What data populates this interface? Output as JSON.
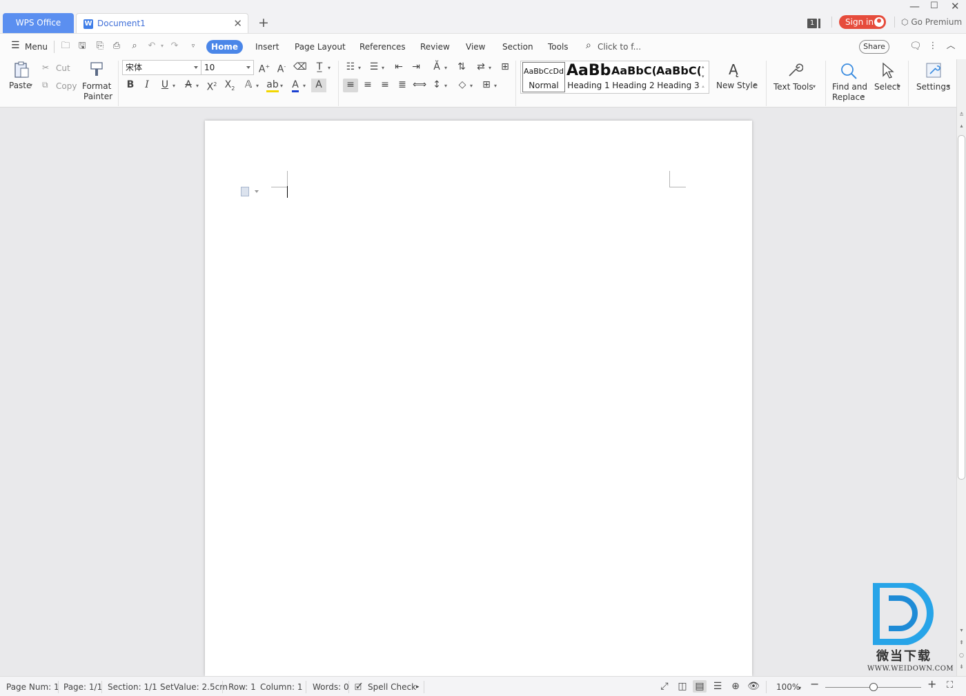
{
  "titlebar": {
    "app_tab": "WPS Office",
    "doc_tab": "Document1",
    "notif_count": "1",
    "sign_in": "Sign in",
    "go_premium": "Go Premium"
  },
  "menu": {
    "menu_label": "Menu",
    "tabs": [
      "Home",
      "Insert",
      "Page Layout",
      "References",
      "Review",
      "View",
      "Section",
      "Tools"
    ],
    "search_placeholder": "Click to f...",
    "share": "Share"
  },
  "ribbon": {
    "paste": "Paste",
    "cut": "Cut",
    "copy": "Copy",
    "format_painter_1": "Format",
    "format_painter_2": "Painter",
    "font_name": "宋体",
    "font_size": "10",
    "styles": [
      {
        "preview": "AaBbCcDd",
        "name": "Normal"
      },
      {
        "preview": "AaBb",
        "name": "Heading 1"
      },
      {
        "preview": "AaBbC(",
        "name": "Heading 2"
      },
      {
        "preview": "AaBbC(",
        "name": "Heading 3"
      }
    ],
    "new_style": "New Style",
    "text_tools": "Text Tools",
    "find_replace_1": "Find and",
    "find_replace_2": "Replace",
    "select": "Select",
    "settings": "Settings"
  },
  "statusbar": {
    "page_num": "Page Num: 1",
    "page": "Page: 1/1",
    "section": "Section: 1/1",
    "setvalue": "SetValue: 2.5cm",
    "row": "Row: 1",
    "column": "Column: 1",
    "words": "Words: 0",
    "spell_check": "Spell Check",
    "zoom": "100%"
  },
  "watermark": {
    "cn": "微当下载",
    "url": "WWW.WEIDOWN.COM"
  },
  "colors": {
    "accent": "#4a86e8",
    "signin": "#e64c3c",
    "wps_tab": "#5b8ff0"
  }
}
